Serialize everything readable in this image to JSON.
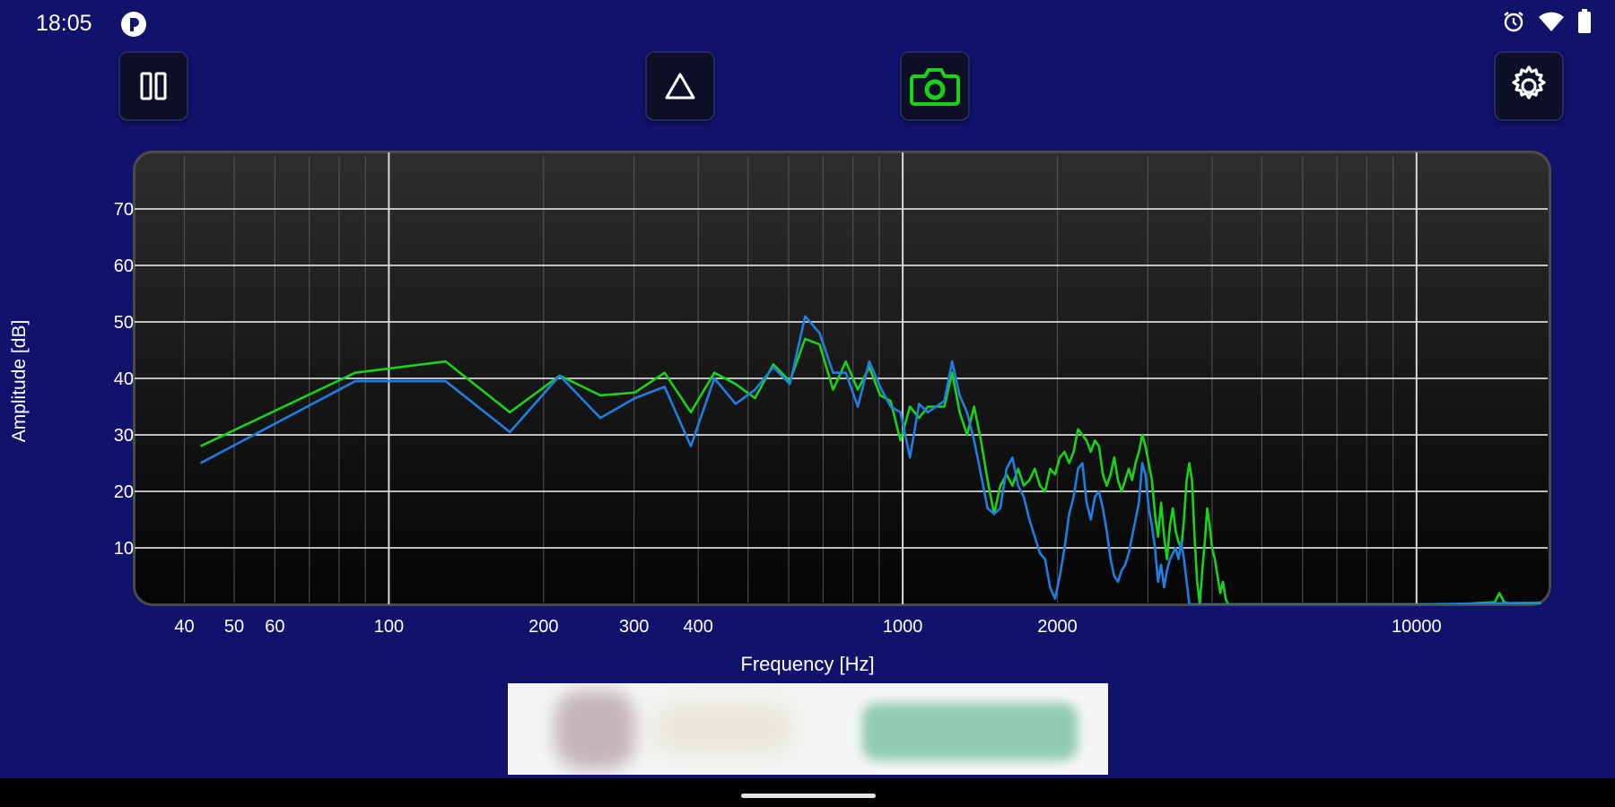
{
  "status_bar": {
    "time": "18:05",
    "app_icon": "notification-app-icon",
    "right_icons": [
      "alarm-icon",
      "wifi-icon",
      "battery-icon"
    ]
  },
  "toolbar": {
    "buttons": [
      {
        "name": "pause-button",
        "icon": "pause-icon"
      },
      {
        "name": "peak-hold-button",
        "icon": "triangle-icon"
      },
      {
        "name": "screenshot-button",
        "icon": "camera-icon",
        "accent": "#18d31a"
      },
      {
        "name": "settings-button",
        "icon": "gear-icon"
      }
    ]
  },
  "ad_banner": {
    "present": true
  },
  "chart_data": {
    "type": "line",
    "xlabel": "Frequency [Hz]",
    "ylabel": "Amplitude [dB]",
    "x_scale": "log",
    "xlim": [
      32,
      18000
    ],
    "ylim": [
      0,
      80
    ],
    "grid": true,
    "y_ticks": [
      10,
      20,
      30,
      40,
      50,
      60,
      70
    ],
    "x_tick_labels": [
      {
        "v": 40,
        "t": "40"
      },
      {
        "v": 50,
        "t": "50"
      },
      {
        "v": 60,
        "t": "60"
      },
      {
        "v": 100,
        "t": "100"
      },
      {
        "v": 200,
        "t": "200"
      },
      {
        "v": 300,
        "t": "300"
      },
      {
        "v": 400,
        "t": "400"
      },
      {
        "v": 1000,
        "t": "1000"
      },
      {
        "v": 2000,
        "t": "2000"
      },
      {
        "v": 10000,
        "t": "10000"
      }
    ],
    "series": [
      {
        "color": "#1ad21a",
        "points": [
          [
            43,
            28
          ],
          [
            86,
            41
          ],
          [
            129,
            43
          ],
          [
            172,
            34
          ],
          [
            215,
            40.5
          ],
          [
            258,
            37
          ],
          [
            301,
            37.5
          ],
          [
            344,
            41
          ],
          [
            387,
            34
          ],
          [
            430,
            41
          ],
          [
            473,
            39
          ],
          [
            516,
            36.5
          ],
          [
            560,
            42.5
          ],
          [
            603,
            39.5
          ],
          [
            646,
            47
          ],
          [
            689,
            46
          ],
          [
            732,
            38
          ],
          [
            775,
            43
          ],
          [
            818,
            38
          ],
          [
            861,
            42
          ],
          [
            904,
            37
          ],
          [
            947,
            36
          ],
          [
            990,
            29
          ],
          [
            1033,
            35
          ],
          [
            1076,
            33
          ],
          [
            1119,
            35
          ],
          [
            1162,
            35
          ],
          [
            1205,
            35
          ],
          [
            1248,
            41
          ],
          [
            1291,
            34
          ],
          [
            1334,
            30
          ],
          [
            1377,
            35
          ],
          [
            1420,
            29
          ],
          [
            1463,
            22
          ],
          [
            1506,
            16
          ],
          [
            1549,
            21
          ],
          [
            1592,
            23
          ],
          [
            1635,
            21
          ],
          [
            1678,
            24
          ],
          [
            1721,
            21
          ],
          [
            1764,
            22
          ],
          [
            1807,
            24
          ],
          [
            1850,
            21
          ],
          [
            1893,
            20
          ],
          [
            1936,
            24
          ],
          [
            1979,
            23
          ],
          [
            2022,
            26
          ],
          [
            2065,
            27
          ],
          [
            2108,
            25
          ],
          [
            2151,
            27
          ],
          [
            2194,
            31
          ],
          [
            2237,
            30
          ],
          [
            2280,
            29
          ],
          [
            2323,
            27
          ],
          [
            2366,
            29
          ],
          [
            2409,
            28
          ],
          [
            2452,
            23
          ],
          [
            2495,
            21
          ],
          [
            2538,
            23
          ],
          [
            2581,
            26
          ],
          [
            2624,
            22
          ],
          [
            2667,
            20
          ],
          [
            2710,
            22
          ],
          [
            2753,
            24
          ],
          [
            2796,
            22
          ],
          [
            2839,
            25
          ],
          [
            2882,
            27
          ],
          [
            2925,
            30
          ],
          [
            2968,
            28
          ],
          [
            3011,
            25
          ],
          [
            3054,
            22
          ],
          [
            3097,
            16
          ],
          [
            3140,
            12
          ],
          [
            3183,
            18
          ],
          [
            3226,
            12
          ],
          [
            3269,
            8
          ],
          [
            3312,
            14
          ],
          [
            3355,
            17
          ],
          [
            3398,
            13
          ],
          [
            3441,
            11
          ],
          [
            3484,
            10
          ],
          [
            3527,
            15
          ],
          [
            3570,
            22
          ],
          [
            3613,
            25
          ],
          [
            3656,
            22
          ],
          [
            3699,
            12
          ],
          [
            3742,
            4
          ],
          [
            3785,
            0
          ],
          [
            3828,
            6
          ],
          [
            3871,
            11
          ],
          [
            3914,
            17
          ],
          [
            3957,
            14
          ],
          [
            4000,
            10
          ],
          [
            4050,
            8
          ],
          [
            4100,
            5
          ],
          [
            4150,
            2
          ],
          [
            4200,
            4
          ],
          [
            4250,
            1
          ],
          [
            4300,
            0
          ],
          [
            4500,
            0
          ],
          [
            6000,
            0
          ],
          [
            9000,
            0
          ],
          [
            12000,
            0
          ],
          [
            14200,
            0.4
          ],
          [
            14500,
            2
          ],
          [
            14800,
            0.4
          ],
          [
            15500,
            0
          ],
          [
            17500,
            0
          ]
        ]
      },
      {
        "color": "#1f7ee0",
        "points": [
          [
            43,
            25
          ],
          [
            86,
            39.5
          ],
          [
            129,
            39.5
          ],
          [
            172,
            30.5
          ],
          [
            215,
            40.5
          ],
          [
            258,
            33
          ],
          [
            301,
            36.5
          ],
          [
            344,
            38.5
          ],
          [
            387,
            28
          ],
          [
            430,
            40
          ],
          [
            473,
            35.5
          ],
          [
            516,
            38
          ],
          [
            560,
            42
          ],
          [
            603,
            39
          ],
          [
            646,
            51
          ],
          [
            689,
            48
          ],
          [
            732,
            41
          ],
          [
            775,
            41
          ],
          [
            818,
            35
          ],
          [
            861,
            43
          ],
          [
            904,
            38.5
          ],
          [
            947,
            35
          ],
          [
            990,
            34
          ],
          [
            1033,
            26
          ],
          [
            1076,
            35.5
          ],
          [
            1119,
            34
          ],
          [
            1162,
            35
          ],
          [
            1205,
            36
          ],
          [
            1248,
            43
          ],
          [
            1291,
            37
          ],
          [
            1334,
            34
          ],
          [
            1377,
            29
          ],
          [
            1420,
            23
          ],
          [
            1463,
            17
          ],
          [
            1506,
            16
          ],
          [
            1549,
            17
          ],
          [
            1592,
            24
          ],
          [
            1635,
            26
          ],
          [
            1678,
            21
          ],
          [
            1721,
            19
          ],
          [
            1764,
            15
          ],
          [
            1807,
            12
          ],
          [
            1850,
            9
          ],
          [
            1893,
            8
          ],
          [
            1936,
            3
          ],
          [
            1979,
            1
          ],
          [
            2022,
            5
          ],
          [
            2065,
            10
          ],
          [
            2108,
            16
          ],
          [
            2151,
            19
          ],
          [
            2194,
            24
          ],
          [
            2237,
            25
          ],
          [
            2280,
            18
          ],
          [
            2323,
            15
          ],
          [
            2366,
            19
          ],
          [
            2409,
            20
          ],
          [
            2452,
            17
          ],
          [
            2495,
            13
          ],
          [
            2538,
            8
          ],
          [
            2581,
            5
          ],
          [
            2624,
            4
          ],
          [
            2667,
            6
          ],
          [
            2710,
            7
          ],
          [
            2753,
            9
          ],
          [
            2796,
            12
          ],
          [
            2839,
            15
          ],
          [
            2882,
            18
          ],
          [
            2925,
            25
          ],
          [
            2968,
            23
          ],
          [
            3011,
            17
          ],
          [
            3054,
            14
          ],
          [
            3097,
            10
          ],
          [
            3140,
            4
          ],
          [
            3183,
            7
          ],
          [
            3226,
            3
          ],
          [
            3269,
            6
          ],
          [
            3312,
            8
          ],
          [
            3355,
            9
          ],
          [
            3398,
            10
          ],
          [
            3441,
            8
          ],
          [
            3484,
            11
          ],
          [
            3527,
            8
          ],
          [
            3570,
            4
          ],
          [
            3613,
            0
          ],
          [
            4000,
            0
          ],
          [
            6000,
            0
          ],
          [
            10000,
            0
          ],
          [
            17500,
            0.3
          ]
        ]
      }
    ]
  }
}
